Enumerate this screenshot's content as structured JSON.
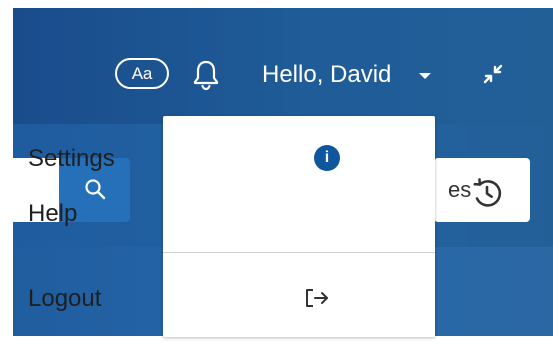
{
  "header": {
    "font_size_button_label": "Aa",
    "bell_icon": "bell-icon",
    "user_greeting": "Hello, David",
    "caret_icon": "chevron-down-icon",
    "minimize_icon": "minimize-icon"
  },
  "search": {
    "placeholder": "",
    "button_icon": "search-icon"
  },
  "history": {
    "label_fragment": "es",
    "icon": "history-icon"
  },
  "menu": {
    "items": [
      {
        "label": "Settings"
      },
      {
        "label": "Help"
      },
      {
        "label": "Logout"
      }
    ],
    "settings_badge": "i",
    "logout_icon": "logout-icon"
  },
  "colors": {
    "header_blue": "#1a4c8c",
    "content_blue": "#1f5d9f",
    "button_blue": "#2670ba",
    "badge_blue": "#10569f",
    "menu_bg": "#ffffff",
    "text_dark": "#1f1f1f",
    "white": "#ffffff"
  }
}
